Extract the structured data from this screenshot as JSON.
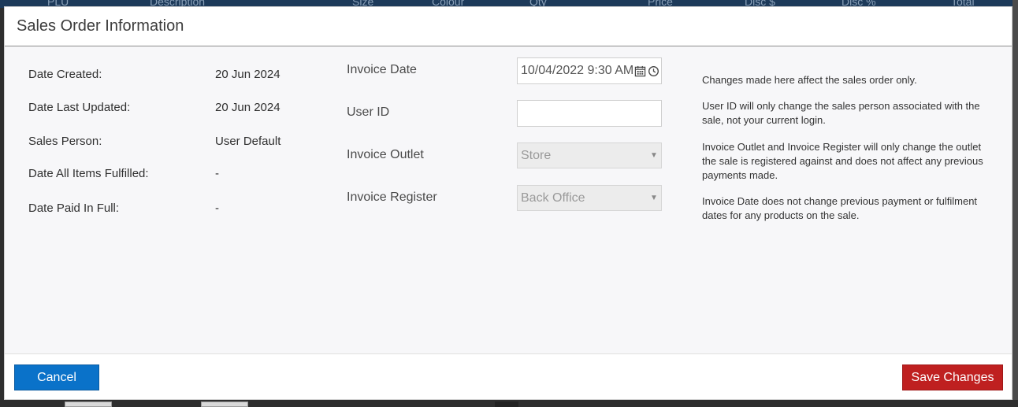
{
  "background": {
    "columns": [
      "PLU",
      "Description",
      "Size",
      "Colour",
      "Qty",
      "Price",
      "Disc $",
      "Disc %",
      "Total"
    ]
  },
  "modal": {
    "title": "Sales Order Information"
  },
  "info": {
    "date_created_label": "Date Created:",
    "date_created_value": "20 Jun 2024",
    "date_updated_label": "Date Last Updated:",
    "date_updated_value": "20 Jun 2024",
    "sales_person_label": "Sales Person:",
    "sales_person_value": "User Default",
    "fulfilled_label": "Date All Items Fulfilled:",
    "fulfilled_value": "-",
    "paid_label": "Date Paid In Full:",
    "paid_value": "-"
  },
  "form": {
    "invoice_date_label": "Invoice Date",
    "invoice_date_value": "10/04/2022 9:30 AM",
    "user_id_label": "User ID",
    "user_id_value": "",
    "outlet_label": "Invoice Outlet",
    "outlet_value": "Store",
    "register_label": "Invoice Register",
    "register_value": "Back Office"
  },
  "help": {
    "line1": "Changes made here affect the sales order only.",
    "line2": "User ID will only change the sales person associated with the sale, not your current login.",
    "line3": "Invoice Outlet and Invoice Register will only change the outlet the sale is registered against and does not affect any previous payments made.",
    "line4": "Invoice Date does not change previous payment or fulfilment dates for any products on the sale."
  },
  "footer": {
    "cancel_label": "Cancel",
    "save_label": "Save Changes"
  },
  "colors": {
    "cancel": "#0a72c9",
    "save": "#bf2020"
  },
  "icons": [
    "calendar-icon",
    "clock-icon",
    "dropdown-caret-icon"
  ]
}
